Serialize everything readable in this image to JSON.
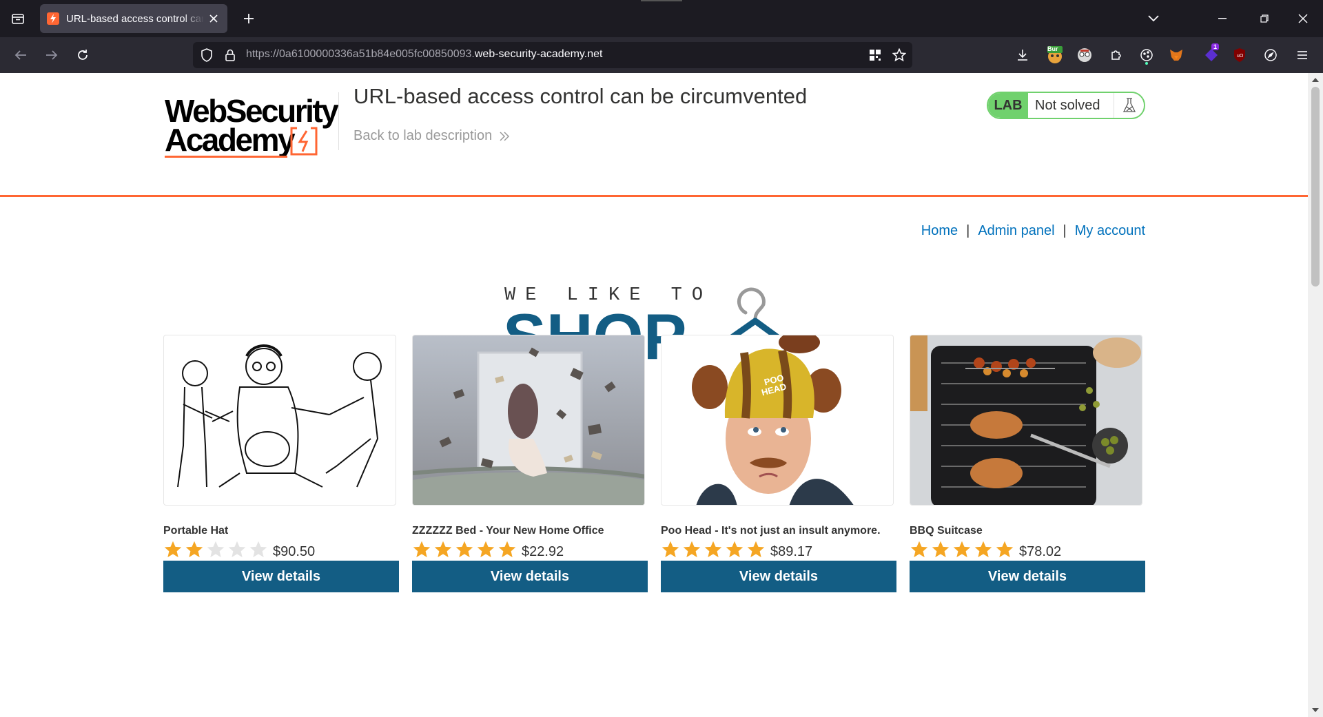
{
  "browser": {
    "tab_title": "URL-based access control can be circumvented",
    "url_prefix": "https://0a6100000336a51b84e005fc00850093.",
    "url_domain": "web-security-academy.net",
    "extensions": [
      "Bur",
      "1"
    ]
  },
  "lab": {
    "logo_line1": "WebSecurity",
    "logo_line2": "Academy",
    "title": "URL-based access control can be circumvented",
    "back_link": "Back to lab description",
    "badge": "LAB",
    "status": "Not solved"
  },
  "nav": {
    "home": "Home",
    "separator": "|",
    "admin": "Admin panel",
    "account": "My account"
  },
  "hero": {
    "small": "WE LIKE TO",
    "big": "SHOP"
  },
  "products": [
    {
      "name": "Portable Hat",
      "rating": 2,
      "price": "$90.50",
      "button": "View details"
    },
    {
      "name": "ZZZZZZ Bed - Your New Home Office",
      "rating": 5,
      "price": "$22.92",
      "button": "View details"
    },
    {
      "name": "Poo Head - It's not just an insult anymore.",
      "rating": 5,
      "price": "$89.17",
      "button": "View details"
    },
    {
      "name": "BBQ Suitcase",
      "rating": 5,
      "price": "$78.02",
      "button": "View details"
    }
  ],
  "colors": {
    "accent": "#ff6633",
    "shop_blue": "#135d84",
    "link": "#0071bc",
    "lab_green": "#70d16d",
    "star": "#f5a623"
  }
}
